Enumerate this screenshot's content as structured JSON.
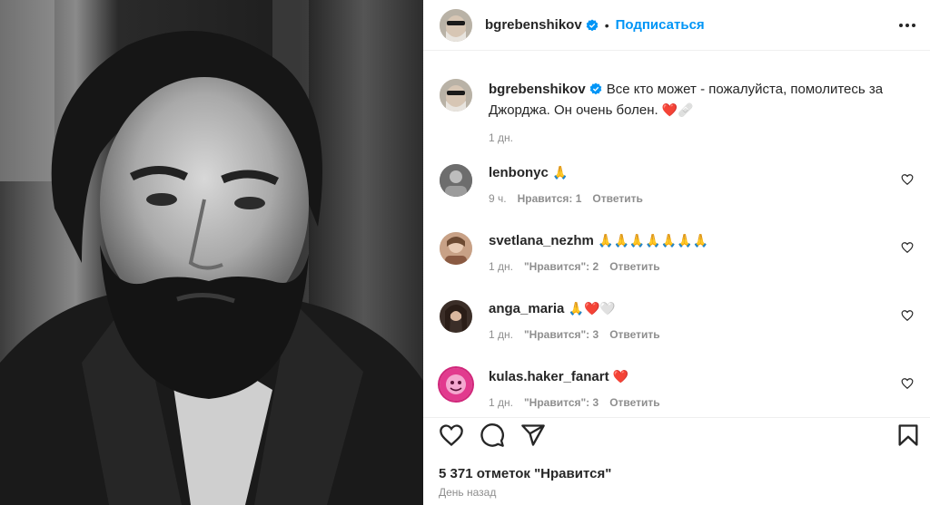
{
  "post": {
    "author": "bgrebenshikov",
    "follow_label": "Подписаться",
    "separator": "•",
    "caption_text": "Все кто может - пожалуйста, помолитесь за Джорджа. Он очень болен.",
    "caption_emoji": "❤️🩹",
    "caption_time": "1 дн.",
    "likes_total": "5 371 отметок \"Нравится\"",
    "post_time": "День назад"
  },
  "comments": [
    {
      "user": "lenbonyc",
      "text": "🙏",
      "time": "9 ч.",
      "likes": "Нравится: 1",
      "reply": "Ответить",
      "avatar_color": "#5a5a5a"
    },
    {
      "user": "svetlana_nezhm",
      "text": "🙏🙏🙏🙏🙏🙏🙏",
      "time": "1 дн.",
      "likes": "\"Нравится\": 2",
      "reply": "Ответить",
      "avatar_color": "#b98a6c"
    },
    {
      "user": "anga_maria",
      "text": "🙏❤️🤍",
      "time": "1 дн.",
      "likes": "\"Нравится\": 3",
      "reply": "Ответить",
      "avatar_color": "#4a3a32"
    },
    {
      "user": "kulas.haker_fanart",
      "text": "❤️",
      "time": "1 дн.",
      "likes": "\"Нравится\": 3",
      "reply": "Ответить",
      "avatar_color": "#d0267a"
    }
  ],
  "colors": {
    "accent_blue": "#0095f6",
    "muted_text": "#8e8e8e",
    "heart_red": "#ed1c24"
  },
  "icons": {
    "verified": "verified-badge-icon",
    "more": "more-options-icon",
    "like": "heart-icon",
    "comment": "comment-icon",
    "share": "share-icon",
    "save": "bookmark-icon"
  }
}
